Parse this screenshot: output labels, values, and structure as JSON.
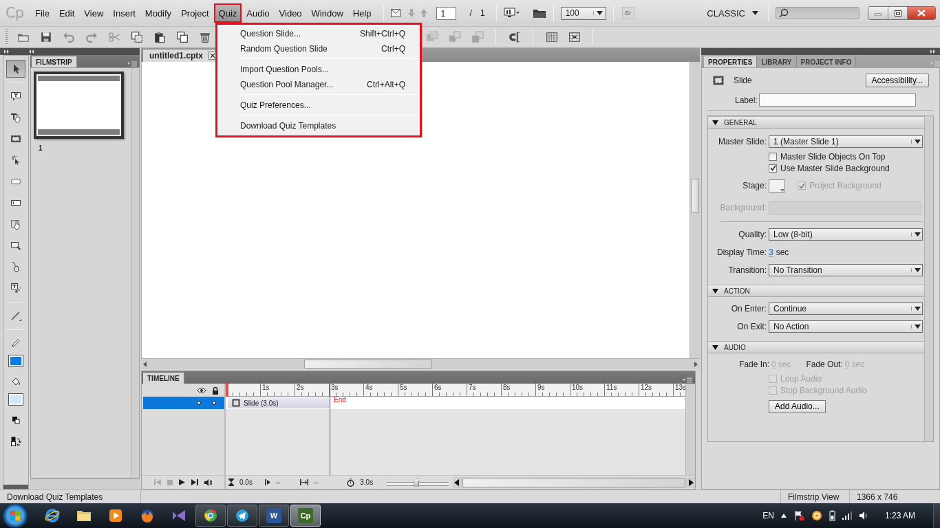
{
  "app": {
    "logo": "Cp"
  },
  "menu": [
    {
      "label": "File",
      "selected": false
    },
    {
      "label": "Edit",
      "selected": false
    },
    {
      "label": "View",
      "selected": false
    },
    {
      "label": "Insert",
      "selected": false
    },
    {
      "label": "Modify",
      "selected": false
    },
    {
      "label": "Project",
      "selected": false
    },
    {
      "label": "Quiz",
      "selected": true
    },
    {
      "label": "Audio",
      "selected": false
    },
    {
      "label": "Video",
      "selected": false
    },
    {
      "label": "Window",
      "selected": false
    },
    {
      "label": "Help",
      "selected": false
    }
  ],
  "quick_bar": {
    "page_current": "1",
    "page_separator": "/",
    "page_total": "1",
    "zoom": "100",
    "bridge": "Br",
    "workspace": "CLASSIC"
  },
  "toolbar": {
    "groups": [
      [
        {
          "kind": "open",
          "disabled": false
        },
        {
          "kind": "save",
          "disabled": false
        },
        {
          "kind": "undo",
          "disabled": true
        },
        {
          "kind": "redo",
          "disabled": true
        },
        {
          "kind": "cut",
          "disabled": true
        },
        {
          "kind": "copy",
          "disabled": false
        },
        {
          "kind": "paste",
          "disabled": false
        },
        {
          "kind": "duplicate",
          "disabled": false
        },
        {
          "kind": "delete",
          "disabled": false
        }
      ],
      [
        {
          "kind": "group",
          "disabled": true
        },
        {
          "kind": "ungroup",
          "disabled": true
        },
        {
          "kind": "arrange",
          "disabled": true
        }
      ],
      [
        {
          "kind": "magnet",
          "disabled": false
        }
      ],
      [
        {
          "kind": "grid",
          "disabled": false
        },
        {
          "kind": "snap",
          "disabled": false
        }
      ]
    ]
  },
  "quiz_menu": {
    "groups": [
      [
        {
          "label": "Question Slide...",
          "shortcut": "Shift+Ctrl+Q"
        },
        {
          "label": "Random Question Slide",
          "shortcut": "Ctrl+Q"
        }
      ],
      [
        {
          "label": "Import Question Pools..."
        },
        {
          "label": "Question Pool Manager...",
          "shortcut": "Ctrl+Alt+Q"
        }
      ],
      [
        {
          "label": "Quiz Preferences..."
        }
      ],
      [
        {
          "label": "Download Quiz Templates"
        }
      ]
    ]
  },
  "tools": [
    {
      "kind": "select",
      "selected": true
    },
    {
      "kind": "separator"
    },
    {
      "kind": "caption",
      "selected": false
    },
    {
      "kind": "rollover_caption",
      "selected": false
    },
    {
      "kind": "highlight",
      "selected": false
    },
    {
      "kind": "click",
      "selected": false
    },
    {
      "kind": "button",
      "selected": false
    },
    {
      "kind": "text_entry",
      "selected": false
    },
    {
      "kind": "rollover_area",
      "selected": false
    },
    {
      "kind": "zoom",
      "selected": false
    },
    {
      "kind": "mouse",
      "selected": false
    },
    {
      "kind": "text_animation",
      "selected": false
    },
    {
      "kind": "separator"
    },
    {
      "kind": "line",
      "selected": false
    },
    {
      "kind": "separator"
    },
    {
      "kind": "pencil",
      "selected": false
    },
    {
      "kind": "swatch",
      "color": "#0a7ee8"
    },
    {
      "kind": "bucket",
      "selected": false
    },
    {
      "kind": "swatch",
      "color": "#cfe6ff"
    },
    {
      "kind": "default_colors",
      "selected": false
    },
    {
      "kind": "swap_colors",
      "selected": false
    }
  ],
  "filmstrip": {
    "title": "FILMSTRIP",
    "slides": [
      {
        "number": "1",
        "selected": true
      }
    ]
  },
  "document": {
    "tab": "untitled1.cptx"
  },
  "timeline": {
    "title": "TIMELINE",
    "ruler": [
      "1s",
      "2s",
      "3s",
      "4s",
      "5s",
      "6s",
      "7s",
      "8s",
      "9s",
      "10s",
      "11s",
      "12s",
      "13s"
    ],
    "layers": [
      {
        "selected": true
      }
    ],
    "slide_bar": "Slide (3.0s)",
    "end_label": "End",
    "readouts": {
      "current": "0.0s",
      "start": "--",
      "duration": "--",
      "total": "3.0s"
    },
    "zoom": {
      "level": 0.48
    }
  },
  "properties": {
    "tabs": [
      {
        "label": "PROPERTIES",
        "selected": true
      },
      {
        "label": "LIBRARY",
        "selected": false
      },
      {
        "label": "PROJECT INFO",
        "selected": false
      }
    ],
    "object": "Slide",
    "accessibility": "Accessibility...",
    "label_field": "Label:",
    "sections": [
      {
        "title": "GENERAL",
        "expanded": true,
        "rows": [
          {
            "kind": "dropdown",
            "label": "Master Slide:",
            "value": "1 (Master Slide 1)"
          },
          {
            "kind": "checkbox",
            "label": "Master Slide Objects On Top",
            "checked": false,
            "disabled": false
          },
          {
            "kind": "checkbox",
            "label": "Use Master Slide Background",
            "checked": true,
            "disabled": false
          },
          {
            "kind": "stage",
            "label": "Stage:",
            "checkbox": {
              "label": "Project Background",
              "checked": true,
              "disabled": true
            }
          },
          {
            "kind": "field",
            "label": "Background:",
            "disabled": true
          },
          {
            "kind": "divider"
          },
          {
            "kind": "dropdown",
            "label": "Quality:",
            "value": "Low (8-bit)"
          },
          {
            "kind": "time",
            "label": "Display Time:",
            "value": "3",
            "unit": "sec"
          },
          {
            "kind": "dropdown",
            "label": "Transition:",
            "value": "No Transition"
          }
        ]
      },
      {
        "title": "ACTION",
        "expanded": true,
        "rows": [
          {
            "kind": "dropdown",
            "label": "On Enter:",
            "value": "Continue"
          },
          {
            "kind": "dropdown",
            "label": "On Exit:",
            "value": "No Action"
          }
        ]
      },
      {
        "title": "AUDIO",
        "expanded": true,
        "rows": [
          {
            "kind": "fade",
            "disabled": true,
            "items": [
              {
                "label": "Fade In:",
                "value": "0",
                "unit": "sec"
              },
              {
                "label": "Fade Out:",
                "value": "0",
                "unit": "sec"
              }
            ]
          },
          {
            "kind": "checkbox",
            "label": "Loop Audio",
            "checked": false,
            "disabled": true
          },
          {
            "kind": "checkbox",
            "label": "Stop Background Audio",
            "checked": false,
            "disabled": true
          },
          {
            "kind": "button",
            "label": "Add Audio..."
          }
        ]
      }
    ]
  },
  "status_bar": {
    "message": "Download Quiz Templates",
    "view": "Filmstrip View",
    "size": "1366 x 746"
  },
  "taskbar": {
    "apps": [
      {
        "kind": "ie",
        "running": false,
        "active": false
      },
      {
        "kind": "folder",
        "running": false,
        "active": false
      },
      {
        "kind": "player",
        "running": false,
        "active": false
      },
      {
        "kind": "firefox",
        "running": false,
        "active": false
      },
      {
        "kind": "studio",
        "running": false,
        "active": false
      },
      {
        "kind": "chrome",
        "running": true,
        "active": false
      },
      {
        "kind": "telegram",
        "running": true,
        "active": false
      },
      {
        "kind": "word",
        "label": "W",
        "running": true,
        "active": false
      },
      {
        "kind": "captivate",
        "label": "Cp",
        "running": true,
        "active": true
      }
    ],
    "language": "EN",
    "time": "1:23 AM"
  }
}
